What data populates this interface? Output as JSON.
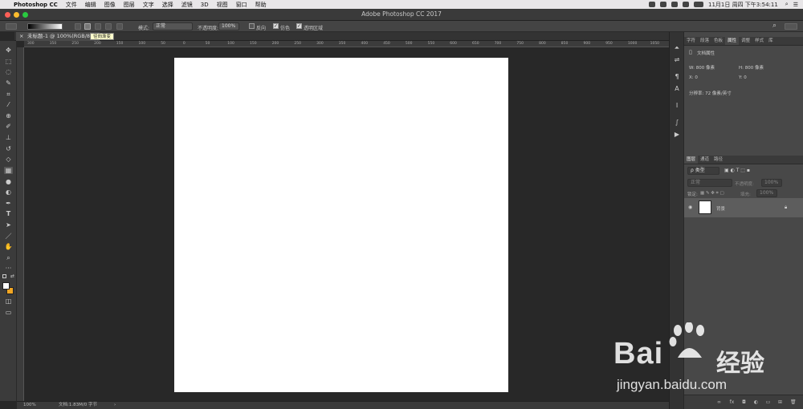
{
  "menubar": {
    "app_name": "Photoshop CC",
    "items": [
      "文件",
      "编辑",
      "图像",
      "图层",
      "文字",
      "选择",
      "滤镜",
      "3D",
      "视图",
      "窗口",
      "帮助"
    ],
    "clock": "11月1日 周四 下午3:54:11"
  },
  "window": {
    "title": "Adobe Photoshop CC 2017"
  },
  "options": {
    "mode_label": "模式:",
    "mode_value": "正常",
    "opacity_label": "不透明度:",
    "opacity_value": "100%",
    "reverse_label": "反向",
    "dither_label": "仿色",
    "transparency_label": "透明区域"
  },
  "tooltip": {
    "text": "径向渐变"
  },
  "document": {
    "tab_title": "未标题-1 @ 100%(RGB/8*)"
  },
  "ruler": {
    "ticks": [
      "300",
      "350",
      "250",
      "200",
      "150",
      "100",
      "50",
      "0",
      "50",
      "100",
      "150",
      "200",
      "250",
      "300",
      "350",
      "400",
      "450",
      "500",
      "550",
      "600",
      "650",
      "700",
      "750",
      "800",
      "850",
      "900",
      "950",
      "1000",
      "1050",
      "1100"
    ]
  },
  "status": {
    "zoom": "100%",
    "doc_info": "文档:1.83M/0 字节"
  },
  "properties": {
    "tabs": [
      "字符",
      "段落",
      "色板",
      "属性",
      "调整",
      "样式",
      "库"
    ],
    "active_tab": "属性",
    "section_title": "文档属性",
    "width": "W: 800 像素",
    "height": "H: 800 像素",
    "x": "X: 0",
    "y": "Y: 0",
    "resolution": "分辨率: 72 像素/英寸"
  },
  "layers": {
    "tabs": [
      "图层",
      "通道",
      "路径"
    ],
    "filter_label": "ρ 类型",
    "blend_mode": "正常",
    "opacity_label": "不透明度:",
    "opacity_value": "100%",
    "lock_label": "锁定:",
    "fill_label": "填充:",
    "fill_value": "100%",
    "layer_name": "背景"
  },
  "watermark": {
    "brand": "Bai",
    "brand2": "经验",
    "url": "jingyan.baidu.com"
  },
  "colors": {
    "foreground": "#ffffff",
    "background": "#f2a623"
  }
}
